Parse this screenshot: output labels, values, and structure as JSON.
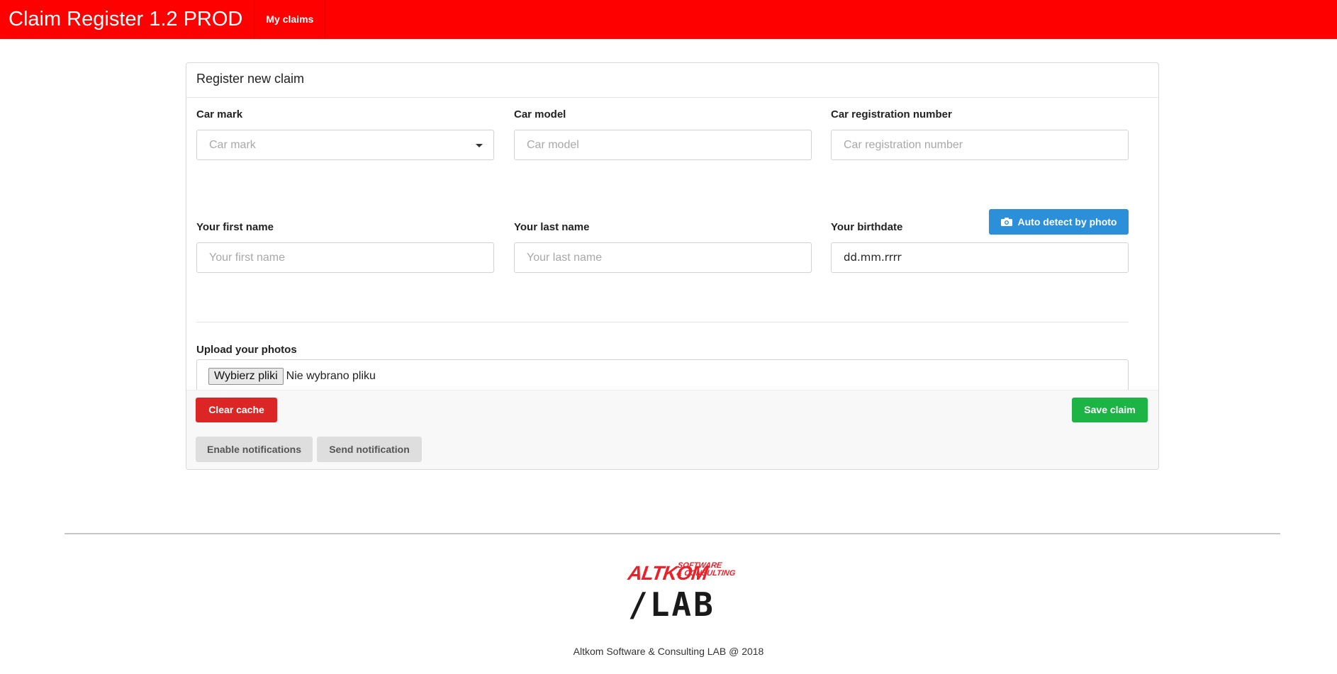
{
  "navbar": {
    "brand": "Claim Register 1.2 PROD",
    "links": [
      {
        "label": "My claims"
      }
    ],
    "color": "#ff0000"
  },
  "card": {
    "title": "Register new claim",
    "car_mark": {
      "label": "Car mark",
      "placeholder": "Car mark",
      "icon": "chevron-down-icon"
    },
    "car_model": {
      "label": "Car model",
      "placeholder": "Car model"
    },
    "car_registration": {
      "label": "Car registration number",
      "placeholder": "Car registration number"
    },
    "auto_detect": {
      "label": "Auto detect by photo",
      "icon": "camera-icon",
      "color": "#2b8fd9"
    },
    "first_name": {
      "label": "Your first name",
      "placeholder": "Your first name"
    },
    "last_name": {
      "label": "Your last name",
      "placeholder": "Your last name"
    },
    "birthdate": {
      "label": "Your birthdate",
      "value": "dd.mm.rrrr"
    },
    "upload": {
      "label": "Upload your photos",
      "button": "Wybierz pliki",
      "status": "Nie wybrano pliku"
    },
    "footer": {
      "clear_cache": "Clear cache",
      "save_claim": "Save claim",
      "enable_notifications": "Enable notifications",
      "send_notification": "Send notification"
    }
  },
  "page_footer": {
    "logo_alt": "ALTKOM",
    "logo_sub_1": "SOFTWARE",
    "logo_sub_2": "& CONSULTING",
    "logo_lab": "/LAB",
    "copyright": "Altkom Software & Consulting LAB @ 2018"
  },
  "colors": {
    "danger": "#dc2626",
    "success": "#1db446",
    "light": "#dedede"
  }
}
